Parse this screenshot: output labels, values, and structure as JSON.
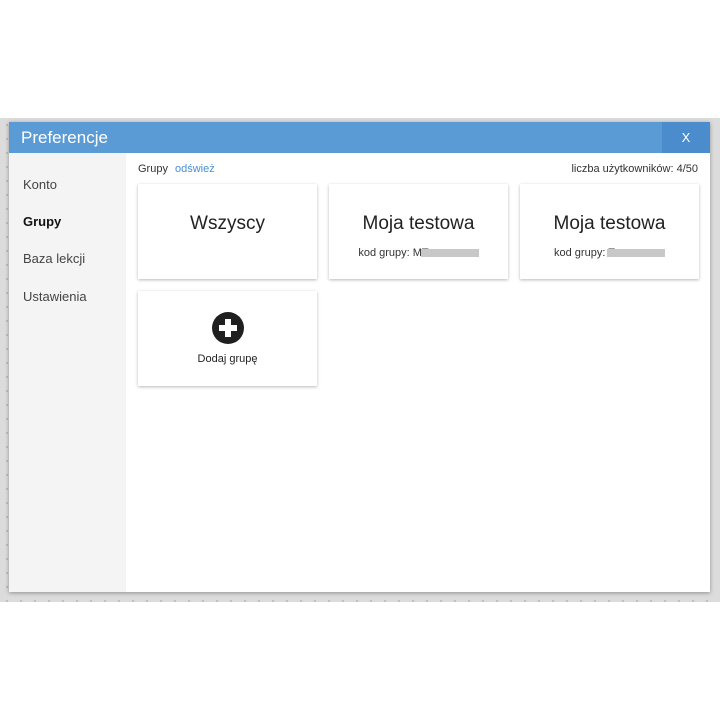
{
  "dialog": {
    "title": "Preferencje",
    "close_label": "X"
  },
  "sidebar": {
    "items": [
      {
        "label": "Konto",
        "active": false
      },
      {
        "label": "Grupy",
        "active": true
      },
      {
        "label": "Baza lekcji",
        "active": false
      },
      {
        "label": "Ustawienia",
        "active": false
      }
    ]
  },
  "groups": {
    "header_label": "Grupy",
    "refresh_label": "odśwież",
    "user_count": "liczba użytkowników: 4/50",
    "cards": [
      {
        "title": "Wszyscy",
        "code": ""
      },
      {
        "title": "Moja testowa",
        "code": "kod grupy: MT"
      },
      {
        "title": "Moja testowa",
        "code": "kod grupy: T"
      }
    ],
    "add_group_label": "Dodaj grupę"
  },
  "icons": {
    "add": "plus-circle-icon"
  },
  "colors": {
    "titlebar": "#5b9bd5",
    "close_button": "#4a8ccc",
    "link": "#4a8fd6",
    "sidebar_bg": "#f4f4f4"
  }
}
